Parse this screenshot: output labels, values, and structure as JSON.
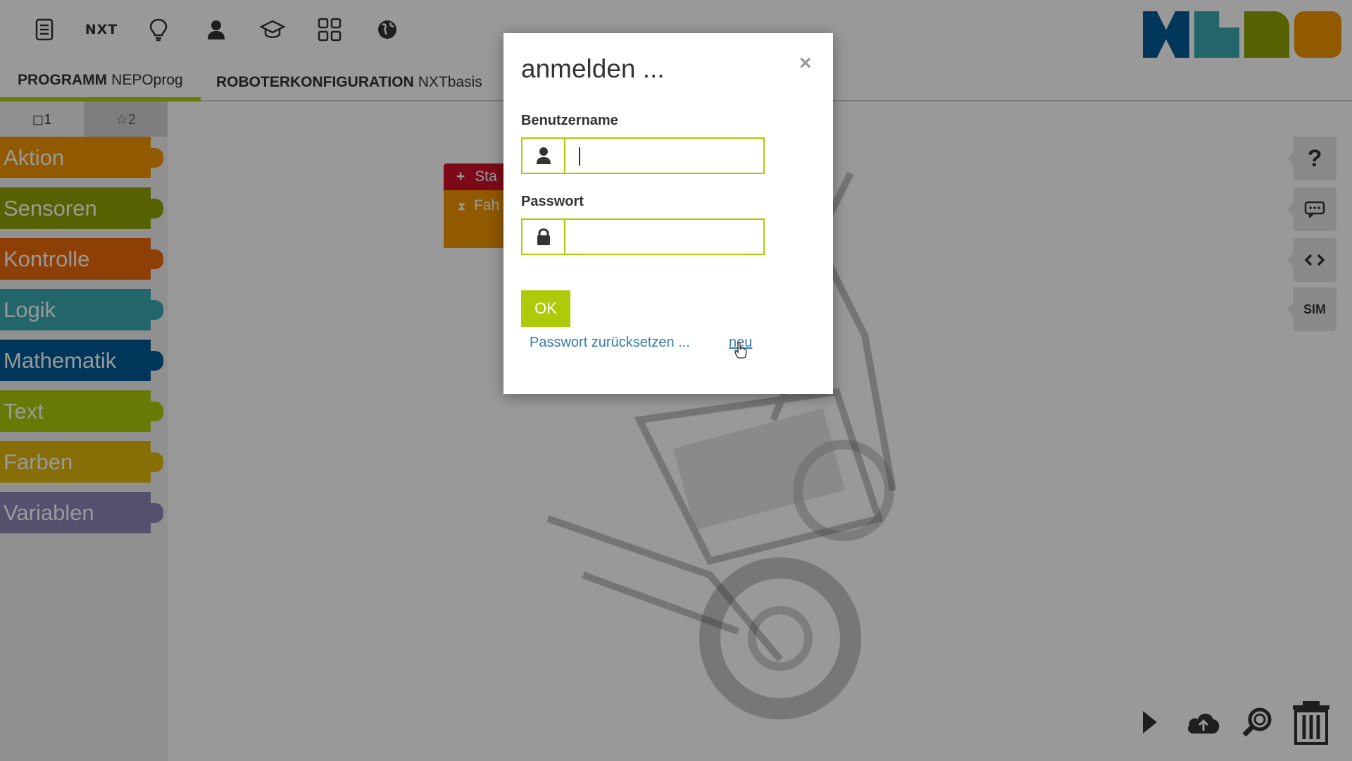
{
  "topbar": {
    "icons": [
      "program-list-icon",
      "nxt-robot-label",
      "lightbulb-icon",
      "user-icon",
      "graduation-cap-icon",
      "gallery-grid-icon",
      "globe-icon"
    ],
    "robot_label": "NXT"
  },
  "tabs": {
    "program": {
      "prefix": "PROGRAMM",
      "name": "NEPOprog"
    },
    "config": {
      "prefix": "ROBOTERKONFIGURATION",
      "name": "NXTbasis"
    }
  },
  "toolbox": {
    "tab1": "◻1",
    "tab2": "☆2",
    "categories": [
      {
        "label": "Aktion",
        "color": "#f29400"
      },
      {
        "label": "Sensoren",
        "color": "#8fa402"
      },
      {
        "label": "Kontrolle",
        "color": "#eb6a0a"
      },
      {
        "label": "Logik",
        "color": "#39abb4"
      },
      {
        "label": "Mathematik",
        "color": "#005a94"
      },
      {
        "label": "Text",
        "color": "#afca0b"
      },
      {
        "label": "Farben",
        "color": "#e2b70b"
      },
      {
        "label": "Variablen",
        "color": "#9085ba"
      }
    ]
  },
  "workspace": {
    "start_block": "Sta",
    "drive_block": "Fah"
  },
  "side_buttons": {
    "help": "?",
    "sim": "SIM"
  },
  "modal": {
    "title": "anmelden ...",
    "close": "×",
    "username_label": "Benutzername",
    "username_value": "",
    "password_label": "Passwort",
    "password_value": "",
    "ok_label": "OK",
    "reset_link": "Passwort zurücksetzen ...",
    "new_link": "neu"
  },
  "colors": {
    "accent": "#afca0b",
    "link": "#337ab7",
    "logo": [
      "#005a94",
      "#39abb4",
      "#8fa402",
      "#f29400"
    ]
  }
}
